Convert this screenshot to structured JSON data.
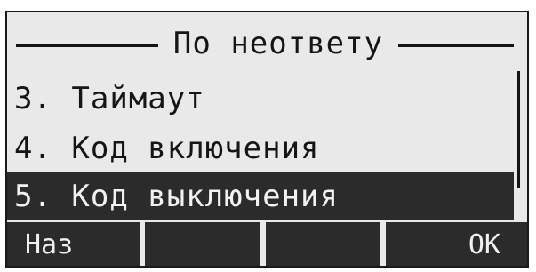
{
  "screen": {
    "title": "По неответу",
    "menu": [
      {
        "label": "3. Таймаут",
        "selected": false
      },
      {
        "label": "4. Код включения",
        "selected": false
      },
      {
        "label": "5. Код выключения",
        "selected": true
      }
    ]
  },
  "softkeys": {
    "k1": "Наз",
    "k2": "",
    "k3": "",
    "k4": "ОК"
  },
  "colors": {
    "lcd_background": "#e9e9e9",
    "lcd_foreground": "#151515",
    "highlight": "#2b2b2b"
  }
}
